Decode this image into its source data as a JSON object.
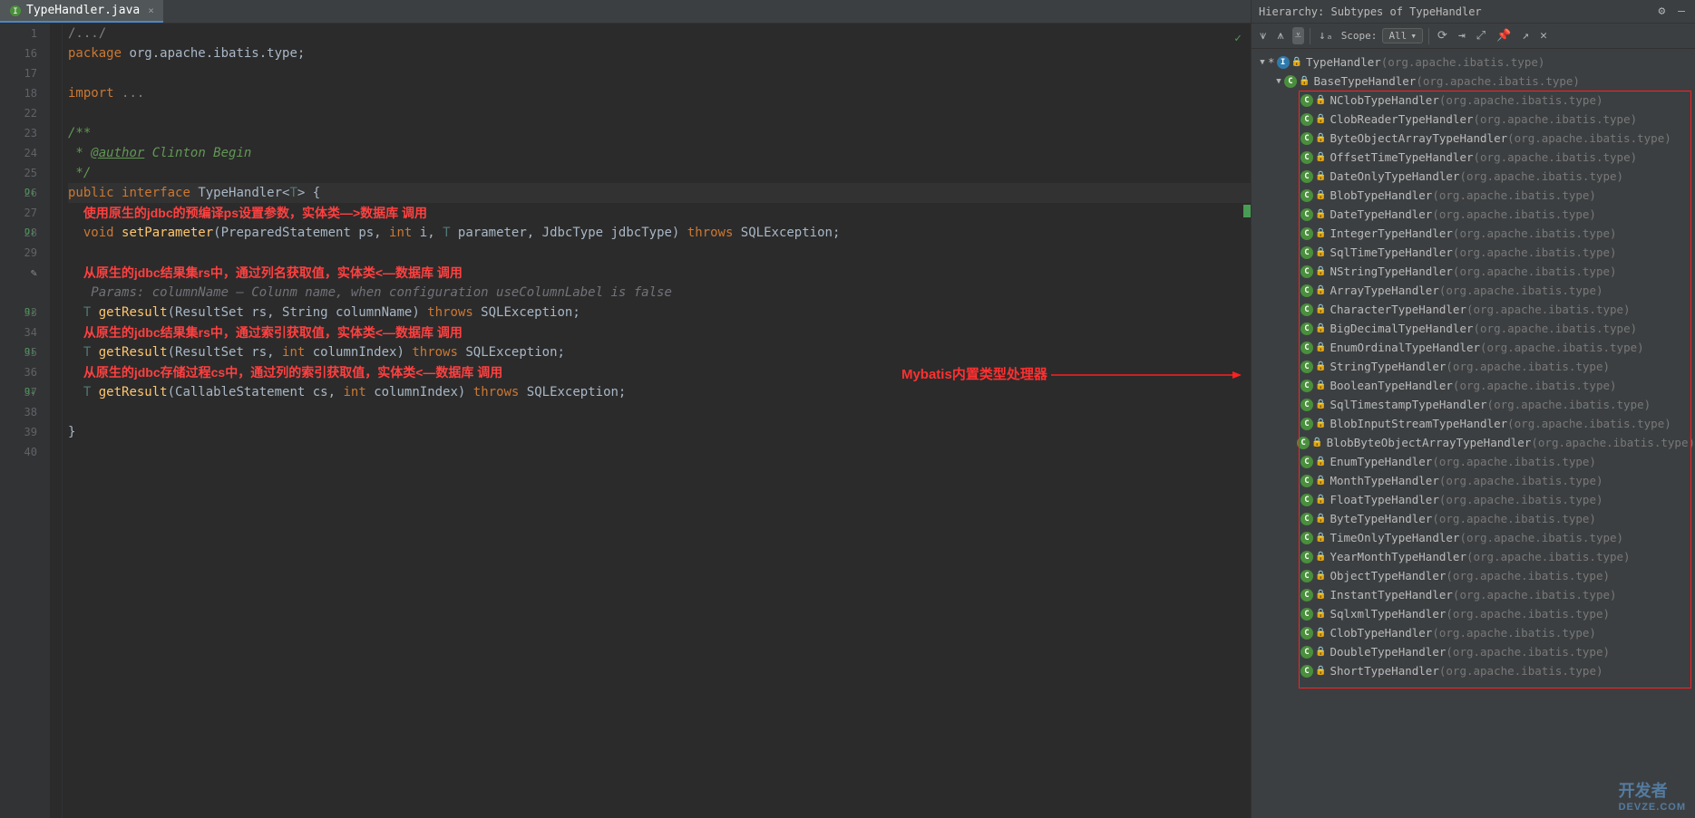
{
  "tab": {
    "filename": "TypeHandler.java"
  },
  "hierarchy": {
    "title": "Hierarchy:  Subtypes of TypeHandler",
    "scope_label": "Scope:",
    "scope_value": "All",
    "root": {
      "name": "TypeHandler",
      "pkg": "(org.apache.ibatis.type)",
      "kind": "intf"
    },
    "base": {
      "name": "BaseTypeHandler",
      "pkg": "(org.apache.ibatis.type)",
      "kind": "cls"
    },
    "handlers": [
      {
        "name": "NClobTypeHandler",
        "pkg": "(org.apache.ibatis.type)"
      },
      {
        "name": "ClobReaderTypeHandler",
        "pkg": "(org.apache.ibatis.type)"
      },
      {
        "name": "ByteObjectArrayTypeHandler",
        "pkg": "(org.apache.ibatis.type)"
      },
      {
        "name": "OffsetTimeTypeHandler",
        "pkg": "(org.apache.ibatis.type)"
      },
      {
        "name": "DateOnlyTypeHandler",
        "pkg": "(org.apache.ibatis.type)"
      },
      {
        "name": "BlobTypeHandler",
        "pkg": "(org.apache.ibatis.type)"
      },
      {
        "name": "DateTypeHandler",
        "pkg": "(org.apache.ibatis.type)"
      },
      {
        "name": "IntegerTypeHandler",
        "pkg": "(org.apache.ibatis.type)"
      },
      {
        "name": "SqlTimeTypeHandler",
        "pkg": "(org.apache.ibatis.type)"
      },
      {
        "name": "NStringTypeHandler",
        "pkg": "(org.apache.ibatis.type)"
      },
      {
        "name": "ArrayTypeHandler",
        "pkg": "(org.apache.ibatis.type)"
      },
      {
        "name": "CharacterTypeHandler",
        "pkg": "(org.apache.ibatis.type)"
      },
      {
        "name": "BigDecimalTypeHandler",
        "pkg": "(org.apache.ibatis.type)"
      },
      {
        "name": "EnumOrdinalTypeHandler",
        "pkg": "(org.apache.ibatis.type)"
      },
      {
        "name": "StringTypeHandler",
        "pkg": "(org.apache.ibatis.type)"
      },
      {
        "name": "BooleanTypeHandler",
        "pkg": "(org.apache.ibatis.type)"
      },
      {
        "name": "SqlTimestampTypeHandler",
        "pkg": "(org.apache.ibatis.type)"
      },
      {
        "name": "BlobInputStreamTypeHandler",
        "pkg": "(org.apache.ibatis.type)"
      },
      {
        "name": "BlobByteObjectArrayTypeHandler",
        "pkg": "(org.apache.ibatis.type)"
      },
      {
        "name": "EnumTypeHandler",
        "pkg": "(org.apache.ibatis.type)"
      },
      {
        "name": "MonthTypeHandler",
        "pkg": "(org.apache.ibatis.type)"
      },
      {
        "name": "FloatTypeHandler",
        "pkg": "(org.apache.ibatis.type)"
      },
      {
        "name": "ByteTypeHandler",
        "pkg": "(org.apache.ibatis.type)"
      },
      {
        "name": "TimeOnlyTypeHandler",
        "pkg": "(org.apache.ibatis.type)"
      },
      {
        "name": "YearMonthTypeHandler",
        "pkg": "(org.apache.ibatis.type)"
      },
      {
        "name": "ObjectTypeHandler",
        "pkg": "(org.apache.ibatis.type)"
      },
      {
        "name": "InstantTypeHandler",
        "pkg": "(org.apache.ibatis.type)"
      },
      {
        "name": "SqlxmlTypeHandler",
        "pkg": "(org.apache.ibatis.type)"
      },
      {
        "name": "ClobTypeHandler",
        "pkg": "(org.apache.ibatis.type)"
      },
      {
        "name": "DoubleTypeHandler",
        "pkg": "(org.apache.ibatis.type)"
      },
      {
        "name": "ShortTypeHandler",
        "pkg": "(org.apache.ibatis.type)"
      }
    ]
  },
  "callout": {
    "label": "Mybatis内置类型处理器"
  },
  "code": {
    "lines": [
      {
        "n": 1,
        "html": "<span class='com'>/.../</span>"
      },
      {
        "n": 16,
        "html": "<span class='kw'>package</span> org.apache.ibatis.type;"
      },
      {
        "n": 17,
        "html": ""
      },
      {
        "n": 18,
        "html": "<span class='kw'>import</span> <span class='com'>...</span>"
      },
      {
        "n": 22,
        "html": ""
      },
      {
        "n": 23,
        "html": "<span class='doc'>/**</span>"
      },
      {
        "n": 24,
        "html": "<span class='doc'> * <span class='doctag'>@author</span> Clinton Begin</span>"
      },
      {
        "n": 25,
        "html": "<span class='doc'> */</span>"
      },
      {
        "n": 26,
        "html": "<span class='kw'>public</span> <span class='kw'>interface</span> <span class='type'>TypeHandler</span>&lt;<span class='gen'>T</span>&gt; {",
        "hl": true,
        "mark": "O↓"
      },
      {
        "n": 27,
        "html": "  <span class='anno-red'>使用原生的jdbc的预编译ps设置参数，实体类—&gt;数据库 调用</span>"
      },
      {
        "n": 28,
        "html": "  <span class='kw'>void</span> <span class='method'>setParameter</span>(PreparedStatement ps, <span class='kw'>int</span> i, <span class='gen'>T</span> parameter, JdbcType jdbcType) <span class='kw'>throws</span> SQLException;",
        "mark": "O↓"
      },
      {
        "n": 29,
        "html": ""
      },
      {
        "n": "",
        "html": "  <span class='anno-red'>从原生的jdbc结果集rs中，通过列名获取值，实体类&lt;—数据库 调用</span>",
        "pencil": true
      },
      {
        "n": "",
        "html": "   <span class='param-hint'>Params: columnName – Colunm name, when configuration useColumnLabel is false</span>"
      },
      {
        "n": 33,
        "html": "  <span class='gen'>T</span> <span class='method'>getResult</span>(ResultSet rs, String columnName) <span class='kw'>throws</span> SQLException;",
        "mark": "O↓"
      },
      {
        "n": 34,
        "html": "  <span class='anno-red'>从原生的jdbc结果集rs中，通过索引获取值，实体类&lt;—数据库 调用</span>"
      },
      {
        "n": 35,
        "html": "  <span class='gen'>T</span> <span class='method'>getResult</span>(ResultSet rs, <span class='kw'>int</span> columnIndex) <span class='kw'>throws</span> SQLException;",
        "mark": "O↓"
      },
      {
        "n": 36,
        "html": "  <span class='anno-red'>从原生的jdbc存储过程cs中，通过列的索引获取值，实体类&lt;—数据库 调用</span>"
      },
      {
        "n": 37,
        "html": "  <span class='gen'>T</span> <span class='method'>getResult</span>(CallableStatement cs, <span class='kw'>int</span> columnIndex) <span class='kw'>throws</span> SQLException;",
        "mark": "O↓"
      },
      {
        "n": 38,
        "html": ""
      },
      {
        "n": 39,
        "html": "}"
      },
      {
        "n": 40,
        "html": ""
      }
    ]
  },
  "watermark": {
    "big": "开发者",
    "small": "DEVZE.COM"
  }
}
